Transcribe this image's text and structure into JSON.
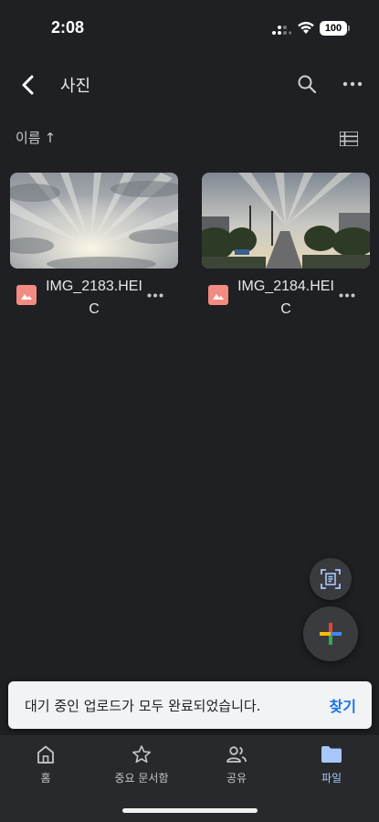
{
  "status_bar": {
    "time": "2:08",
    "battery": "100"
  },
  "header": {
    "title": "사진"
  },
  "sort": {
    "label": "이름",
    "direction_glyph": "↑"
  },
  "files": [
    {
      "name": "IMG_2183.HEIC",
      "icon": "image-icon",
      "thumbnail": "cloudy-sky-sun-rays"
    },
    {
      "name": "IMG_2184.HEIC",
      "icon": "image-icon",
      "thumbnail": "street-sunset-trees"
    }
  ],
  "snackbar": {
    "message": "대기 중인 업로드가 모두 완료되었습니다.",
    "action": "찾기"
  },
  "bottom_nav": [
    {
      "label": "홈",
      "icon": "home-icon",
      "active": false
    },
    {
      "label": "중요 문서함",
      "icon": "star-icon",
      "active": false
    },
    {
      "label": "공유",
      "icon": "people-icon",
      "active": false
    },
    {
      "label": "파일",
      "icon": "folder-icon",
      "active": true
    }
  ],
  "colors": {
    "background": "#1f2023",
    "file_icon": "#f28b82",
    "accent": "#a8c7fa",
    "snackbar_action": "#1a73e8"
  }
}
